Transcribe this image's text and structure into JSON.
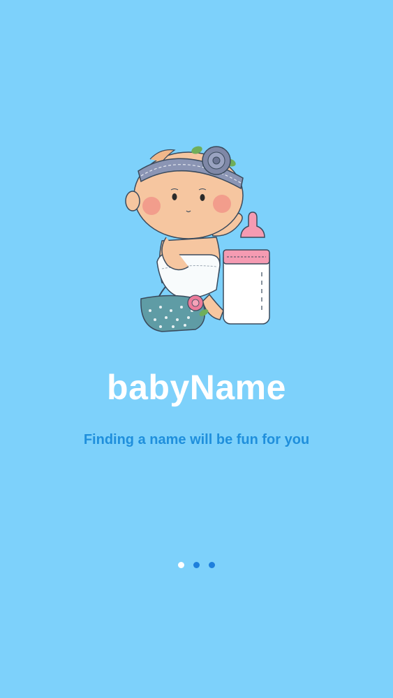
{
  "app": {
    "title": "babyName",
    "tagline": "Finding a name will be fun for you"
  },
  "illustration": {
    "icon": "baby-with-bottle-illustration"
  },
  "pager": {
    "count": 3,
    "active_index": 0,
    "active_color": "#ffffff",
    "inactive_color": "#1e7fdc"
  },
  "colors": {
    "background": "#7dd1fb",
    "title": "#ffffff",
    "tagline": "#1f8fdc"
  }
}
